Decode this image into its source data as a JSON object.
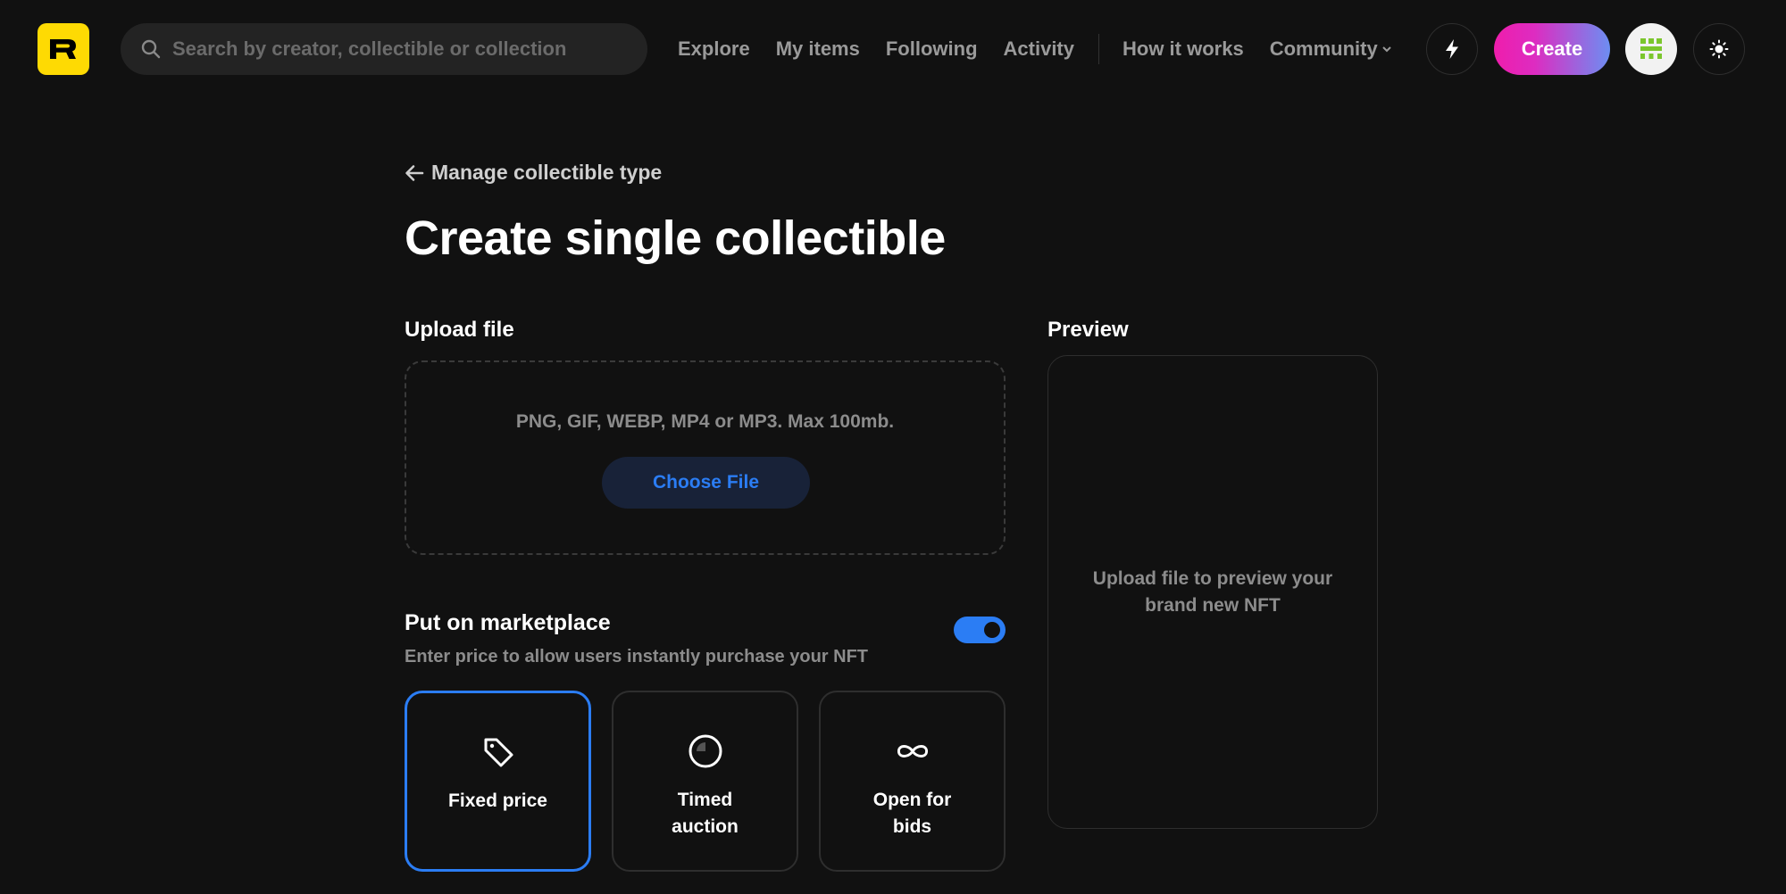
{
  "header": {
    "logo_letter": "R",
    "search_placeholder": "Search by creator, collectible or collection",
    "nav": {
      "explore": "Explore",
      "my_items": "My items",
      "following": "Following",
      "activity": "Activity",
      "how_it_works": "How it works",
      "community": "Community"
    },
    "create_label": "Create",
    "icons": [
      "search-icon",
      "lightning-icon",
      "avatar-icon",
      "sun-icon",
      "chevron-down-icon"
    ]
  },
  "main": {
    "back_label": "Manage collectible type",
    "title": "Create single collectible",
    "upload": {
      "label": "Upload file",
      "hint": "PNG, GIF, WEBP, MP4 or MP3. Max 100mb.",
      "button": "Choose File"
    },
    "preview": {
      "label": "Preview",
      "placeholder": "Upload file to preview your brand new NFT"
    },
    "marketplace": {
      "title": "Put on marketplace",
      "description": "Enter price to allow users instantly purchase your NFT",
      "enabled": true,
      "options": [
        {
          "label": "Fixed price",
          "icon": "price-tag-icon",
          "selected": true
        },
        {
          "label": "Timed auction",
          "icon": "clock-icon",
          "selected": false
        },
        {
          "label": "Open for bids",
          "icon": "infinity-icon",
          "selected": false
        }
      ]
    }
  },
  "colors": {
    "background": "#111111",
    "accent_blue": "#2B7DF4",
    "logo_yellow": "#FEDA03",
    "create_gradient_start": "#EF1DAC",
    "create_gradient_end": "#6C8EF2",
    "muted_text": "#8c8c8c"
  }
}
